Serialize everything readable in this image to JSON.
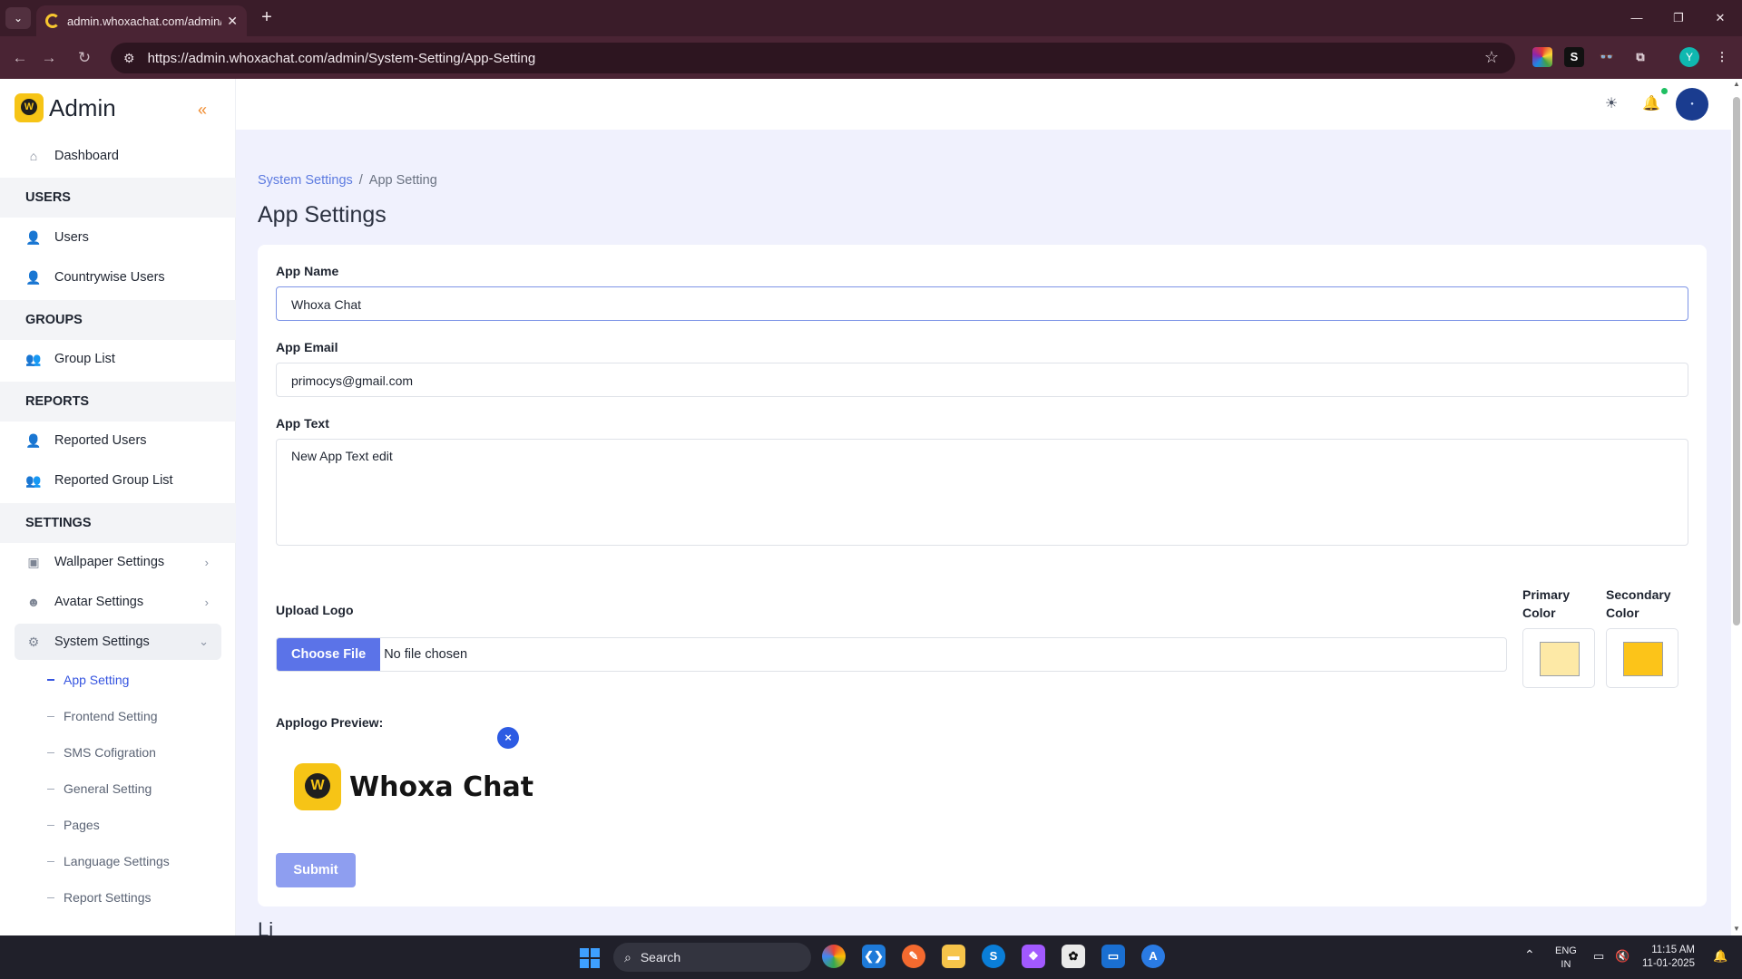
{
  "browser": {
    "tab_title": "admin.whoxachat.com/admin/S",
    "url": "https://admin.whoxachat.com/admin/System-Setting/App-Setting"
  },
  "sidebar": {
    "brand": "Admin",
    "dashboard": "Dashboard",
    "sections": {
      "users": "USERS",
      "groups": "GROUPS",
      "reports": "REPORTS",
      "settings": "SETTINGS"
    },
    "items": {
      "users": "Users",
      "countrywise": "Countrywise Users",
      "group_list": "Group List",
      "reported_users": "Reported Users",
      "reported_groups": "Reported Group List",
      "wallpaper": "Wallpaper Settings",
      "avatar": "Avatar Settings",
      "system": "System Settings"
    },
    "subitems": {
      "app_setting": "App Setting",
      "frontend": "Frontend Setting",
      "sms": "SMS Cofigration",
      "general": "General Setting",
      "pages": "Pages",
      "language": "Language Settings",
      "report": "Report Settings"
    }
  },
  "breadcrumb": {
    "parent": "System Settings",
    "separator": "/",
    "current": "App Setting"
  },
  "page_title": "App Settings",
  "form": {
    "app_name_label": "App Name",
    "app_name_value": "Whoxa Chat",
    "app_email_label": "App Email",
    "app_email_value": "primocys@gmail.com",
    "app_text_label": "App Text",
    "app_text_value": "New App Text edit",
    "upload_logo_label": "Upload Logo",
    "choose_file": "Choose File",
    "no_file": "No file chosen",
    "primary_color_label": "Primary Color",
    "secondary_color_label": "Secondary Color",
    "primary_color": "#fde9a6",
    "secondary_color": "#fcc419",
    "preview_label": "Applogo Preview:",
    "preview_name": "Whoxa Chat",
    "remove_symbol": "×",
    "submit": "Submit"
  },
  "below_text": "Li",
  "taskbar": {
    "search": "Search",
    "lang_1": "ENG",
    "lang_2": "IN",
    "time": "11:15 AM",
    "date": "11-01-2025"
  },
  "colors": {
    "accent": "#3554e0",
    "content_bg": "#f0f1fd",
    "brand_yellow": "#f6c416"
  }
}
